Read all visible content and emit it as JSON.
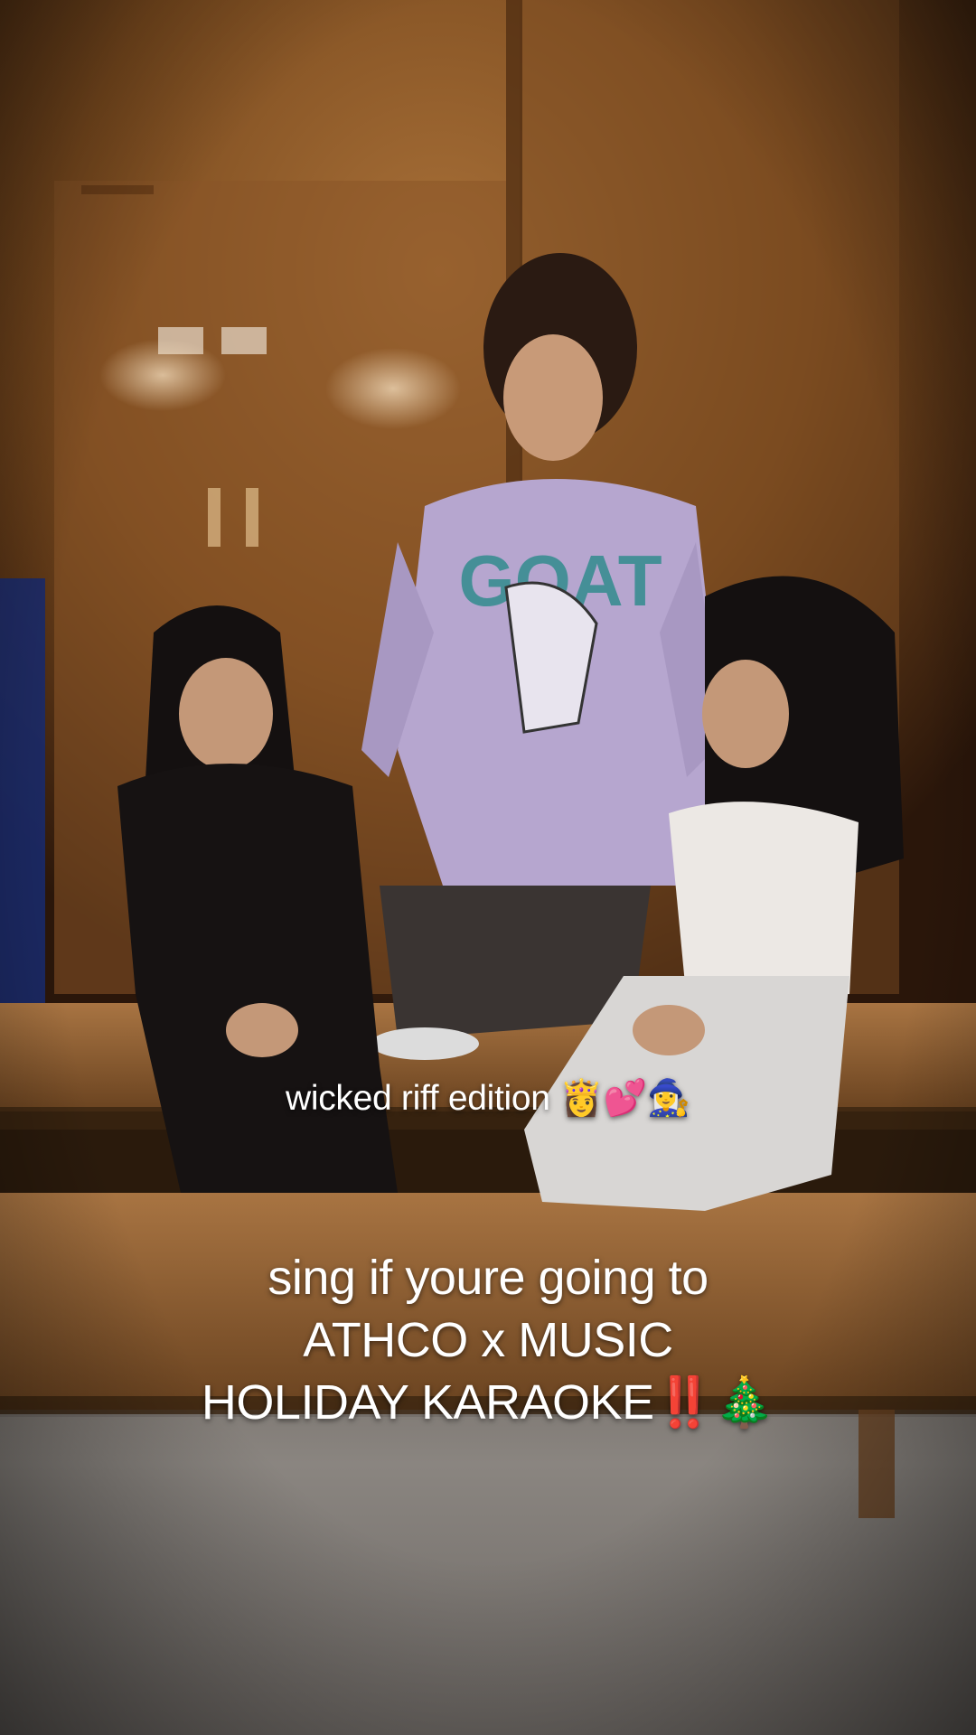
{
  "video": {
    "scene_description_icon": "photo-scene"
  },
  "overlay": {
    "top_caption": "wicked riff edition 👸💕🧙‍♀️",
    "main_caption": {
      "line1": "sing if youre going to",
      "line2": "ATHCO x MUSIC",
      "line3": "HOLIDAY KARAOKE‼️🎄"
    }
  },
  "colors": {
    "wall": "#8a5a28",
    "floor": "#7a7570",
    "bench": "#9a6a38",
    "caption": "#ffffff"
  }
}
